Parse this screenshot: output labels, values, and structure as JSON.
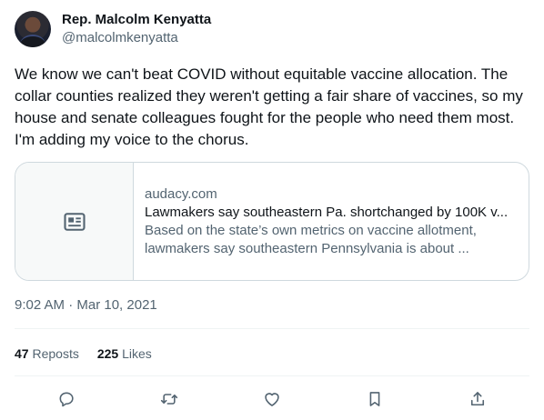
{
  "user": {
    "display_name": "Rep. Malcolm Kenyatta",
    "handle": "@malcolmkenyatta"
  },
  "tweet": {
    "text": "We know we can't beat COVID without equitable vaccine allocation. The collar counties realized they weren't getting a fair share of vaccines, so my house and senate colleagues fought for the people who need them most. I'm adding my voice to the chorus.",
    "timestamp": "9:02 AM · Mar 10, 2021"
  },
  "card": {
    "thumbnail_icon": "article-icon",
    "domain": "audacy.com",
    "title": "Lawmakers say southeastern Pa. shortchanged by 100K v...",
    "description": "Based on the state’s own metrics on vaccine allotment, lawmakers say southeastern Pennsylvania is about ..."
  },
  "stats": {
    "reposts_count": "47",
    "reposts_label": "Reposts",
    "likes_count": "225",
    "likes_label": "Likes"
  },
  "actions": [
    {
      "name": "reply",
      "icon": "reply-icon"
    },
    {
      "name": "repost",
      "icon": "repost-icon"
    },
    {
      "name": "like",
      "icon": "heart-icon"
    },
    {
      "name": "bookmark",
      "icon": "bookmark-icon"
    },
    {
      "name": "share",
      "icon": "share-icon"
    }
  ],
  "colors": {
    "text_primary": "#0f1419",
    "text_secondary": "#536471",
    "border": "#cfd9de",
    "divider": "#eff3f4",
    "thumb_bg": "#f7f9f9"
  }
}
